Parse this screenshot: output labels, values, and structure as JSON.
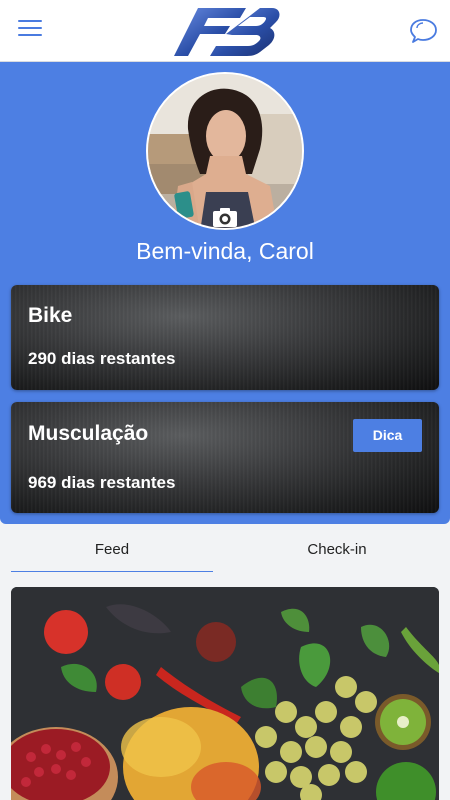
{
  "header": {
    "menu_icon": "hamburger-menu-icon",
    "logo_icon": "fb-logo-icon",
    "chat_icon": "chat-bubbles-icon",
    "accent_color": "#4d7fe3"
  },
  "profile": {
    "welcome": "Bem-vinda, Carol",
    "camera_icon": "camera-icon"
  },
  "plans": [
    {
      "name": "Bike",
      "remaining": "290 dias restantes"
    },
    {
      "name": "Musculação",
      "remaining": "969 dias restantes",
      "tip_label": "Dica"
    }
  ],
  "tabs": [
    {
      "label": "Feed",
      "active": true
    },
    {
      "label": "Check-in",
      "active": false
    }
  ],
  "feed": {
    "image_icon": "vegetables-fruits-photo"
  }
}
